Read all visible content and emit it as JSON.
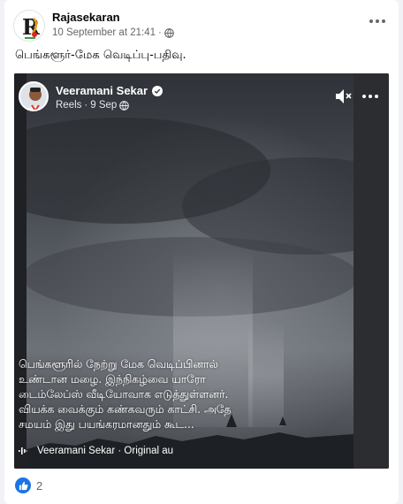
{
  "post": {
    "author": "Rajasekaran",
    "timestamp": "10 September at 21:41",
    "separator": "·",
    "privacy_icon": "globe-icon",
    "caption": "பெங்களூர்-மேக வெடிப்பு-பதிவு."
  },
  "shared_reel": {
    "author": "Veeramani Sekar",
    "verified_icon": "verified-badge-icon",
    "type": "Reels",
    "date": "9 Sep",
    "separator": "·",
    "text_lines": [
      "பெங்களூரில் நேற்று மேக வெடிப்பினால்",
      "உண்டான மழை. இந்நிகழ்வை யாரோ",
      "டைம்லேப்ஸ் வீடியோவாக எடுத்துள்ளனர்.",
      "வியக்க வைக்கும் கண்கவரும் காட்சி. அதே",
      "சமயம் இது பயங்கரமானதும் கூட..."
    ],
    "audio_label": "Veeramani Sekar · Original au"
  },
  "reactions": {
    "icon": "like-icon",
    "count": "2"
  },
  "colors": {
    "accent": "#1b74e4",
    "secondary_text": "#65676b"
  }
}
